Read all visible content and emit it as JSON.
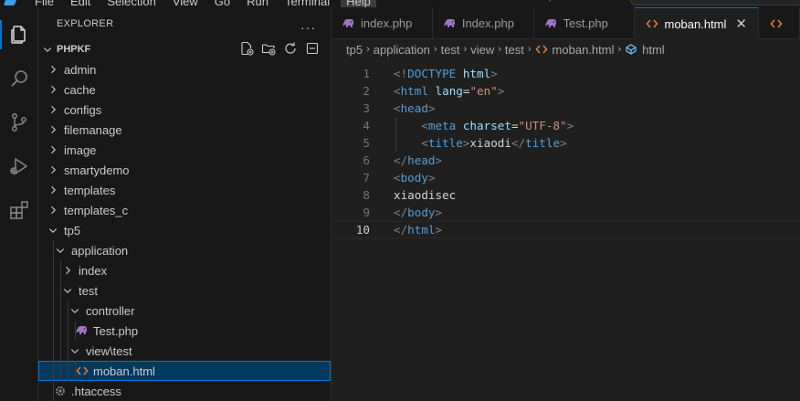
{
  "menu": [
    "File",
    "Edit",
    "Selection",
    "View",
    "Go",
    "Run",
    "Terminal",
    "Help"
  ],
  "sidebar": {
    "title": "EXPLORER",
    "more": "···",
    "section": "PHPKF",
    "tree": [
      {
        "label": "admin",
        "depth": 0,
        "kind": "folder",
        "open": false
      },
      {
        "label": "cache",
        "depth": 0,
        "kind": "folder",
        "open": false
      },
      {
        "label": "configs",
        "depth": 0,
        "kind": "folder",
        "open": false
      },
      {
        "label": "filemanage",
        "depth": 0,
        "kind": "folder",
        "open": false
      },
      {
        "label": "image",
        "depth": 0,
        "kind": "folder",
        "open": false
      },
      {
        "label": "smartydemo",
        "depth": 0,
        "kind": "folder",
        "open": false
      },
      {
        "label": "templates",
        "depth": 0,
        "kind": "folder",
        "open": false
      },
      {
        "label": "templates_c",
        "depth": 0,
        "kind": "folder",
        "open": false
      },
      {
        "label": "tp5",
        "depth": 0,
        "kind": "folder",
        "open": true
      },
      {
        "label": "application",
        "depth": 1,
        "kind": "folder",
        "open": true
      },
      {
        "label": "index",
        "depth": 2,
        "kind": "folder",
        "open": false
      },
      {
        "label": "test",
        "depth": 2,
        "kind": "folder",
        "open": true
      },
      {
        "label": "controller",
        "depth": 3,
        "kind": "folder",
        "open": true
      },
      {
        "label": "Test.php",
        "depth": 4,
        "kind": "php"
      },
      {
        "label": "view\\test",
        "depth": 3,
        "kind": "folder",
        "open": true
      },
      {
        "label": "moban.html",
        "depth": 4,
        "kind": "html",
        "selected": true
      },
      {
        "label": ".htaccess",
        "depth": 1,
        "kind": "gear"
      }
    ]
  },
  "tabs": [
    {
      "label": "index.php",
      "icon": "php-elephant-icon"
    },
    {
      "label": "Index.php",
      "icon": "php-elephant-icon"
    },
    {
      "label": "Test.php",
      "icon": "php-elephant-icon"
    },
    {
      "label": "moban.html",
      "icon": "html-icon",
      "active": true
    },
    {
      "label": "",
      "icon": "html-icon"
    }
  ],
  "breadcrumb": [
    "tp5",
    "application",
    "test",
    "view",
    "test",
    "moban.html",
    "html"
  ],
  "editor": {
    "current_line": 10,
    "lines": [
      [
        [
          "br",
          "<!"
        ],
        [
          "tag",
          "DOCTYPE"
        ],
        [
          "txt",
          " "
        ],
        [
          "attr",
          "html"
        ],
        [
          "br",
          ">"
        ]
      ],
      [
        [
          "br",
          "<"
        ],
        [
          "tag",
          "html"
        ],
        [
          "txt",
          " "
        ],
        [
          "attr",
          "lang"
        ],
        [
          "txt",
          "="
        ],
        [
          "val",
          "\"en\""
        ],
        [
          "br",
          ">"
        ]
      ],
      [
        [
          "br",
          "<"
        ],
        [
          "tag",
          "head"
        ],
        [
          "br",
          ">"
        ]
      ],
      [
        [
          "txt",
          "    "
        ],
        [
          "br",
          "<"
        ],
        [
          "tag",
          "meta"
        ],
        [
          "txt",
          " "
        ],
        [
          "attr",
          "charset"
        ],
        [
          "txt",
          "="
        ],
        [
          "val",
          "\"UTF-8\""
        ],
        [
          "br",
          ">"
        ]
      ],
      [
        [
          "txt",
          "    "
        ],
        [
          "br",
          "<"
        ],
        [
          "tag",
          "title"
        ],
        [
          "br",
          ">"
        ],
        [
          "txt",
          "xiaodi"
        ],
        [
          "br",
          "</"
        ],
        [
          "tag",
          "title"
        ],
        [
          "br",
          ">"
        ]
      ],
      [
        [
          "br",
          "</"
        ],
        [
          "tag",
          "head"
        ],
        [
          "br",
          ">"
        ]
      ],
      [
        [
          "br",
          "<"
        ],
        [
          "tag",
          "body"
        ],
        [
          "br",
          ">"
        ]
      ],
      [
        [
          "txt",
          "xiaodisec"
        ]
      ],
      [
        [
          "br",
          "</"
        ],
        [
          "tag",
          "body"
        ],
        [
          "br",
          ">"
        ]
      ],
      [
        [
          "br",
          "</"
        ],
        [
          "tag",
          "html"
        ],
        [
          "br",
          ">"
        ]
      ]
    ]
  },
  "colors": {
    "accent": "#0078d4",
    "selection": "#04395e",
    "php": "#a074c4",
    "html": "#e37933"
  }
}
